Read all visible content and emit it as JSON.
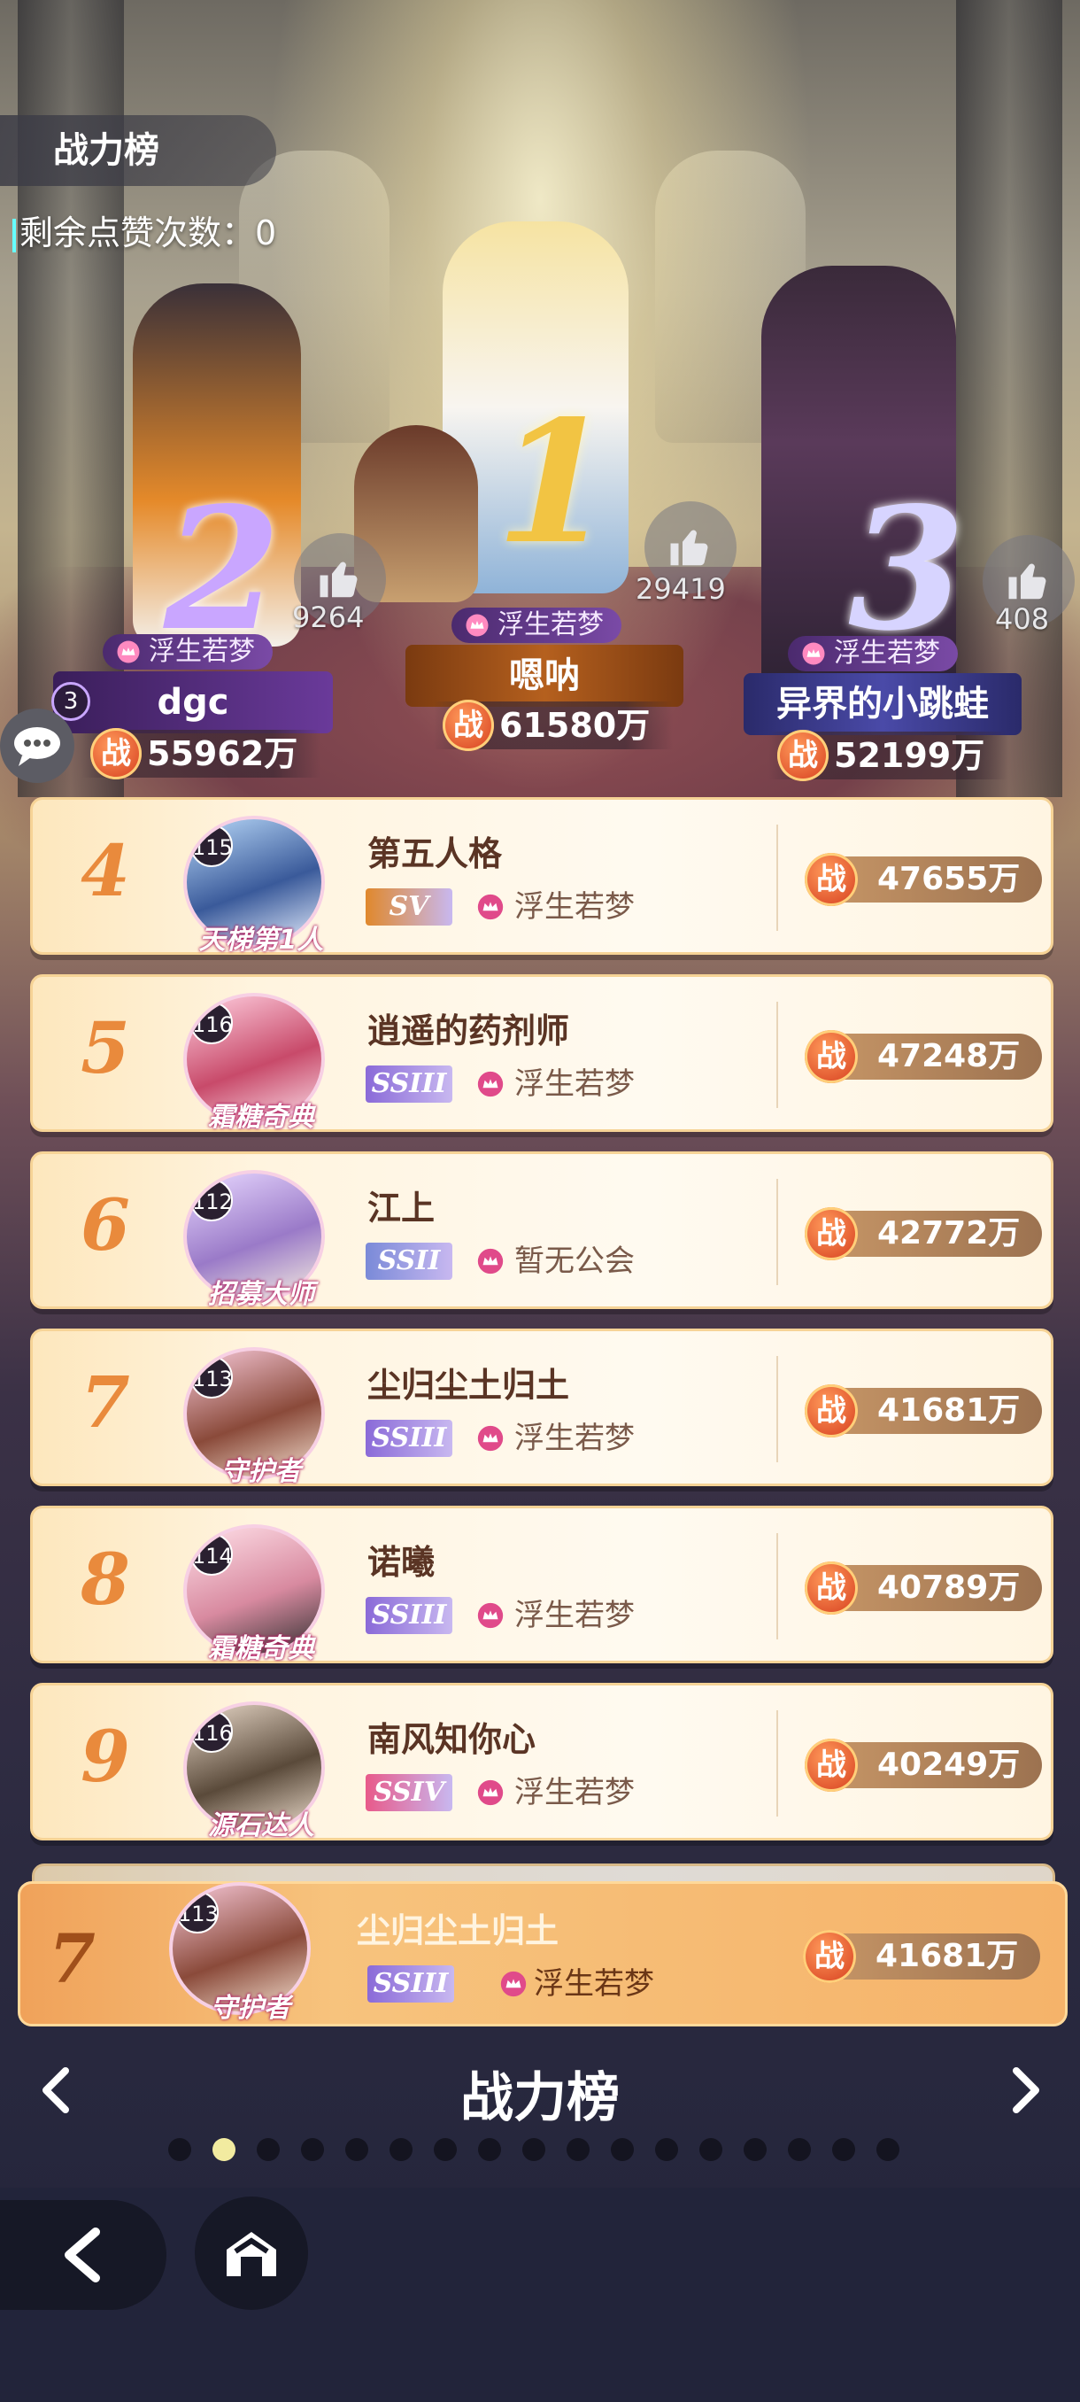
{
  "header": {
    "title": "战力榜",
    "likes_left_label": "剩余点赞次数：",
    "likes_left_value": "0"
  },
  "podium": [
    {
      "rank": "1",
      "guild": "浮生若梦",
      "name": "嗯呐",
      "power": "61580万",
      "likes": "29419"
    },
    {
      "rank": "2",
      "guild": "浮生若梦",
      "name": "dgc",
      "power": "55962万",
      "likes": "9264",
      "level": "3"
    },
    {
      "rank": "3",
      "guild": "浮生若梦",
      "name": "异界的小跳蛙",
      "power": "52199万",
      "likes": "408"
    }
  ],
  "zhan_label": "战",
  "rows": [
    {
      "rank": "4",
      "level": "115",
      "frame": "天梯第1人",
      "name": "第五人格",
      "vip": "SV",
      "vip_color": "#e0882c",
      "guild": "浮生若梦",
      "power": "47655万"
    },
    {
      "rank": "5",
      "level": "116",
      "frame": "霜糖奇典",
      "name": "逍遥的药剂师",
      "vip": "SSIII",
      "vip_color": "#8a6ad8",
      "guild": "浮生若梦",
      "power": "47248万"
    },
    {
      "rank": "6",
      "level": "112",
      "frame": "招募大师",
      "name": "江上",
      "vip": "SSII",
      "vip_color": "#7a8ad8",
      "guild": "暂无公会",
      "power": "42772万"
    },
    {
      "rank": "7",
      "level": "113",
      "frame": "守护者",
      "name": "尘归尘土归土",
      "vip": "SSIII",
      "vip_color": "#8a6ad8",
      "guild": "浮生若梦",
      "power": "41681万"
    },
    {
      "rank": "8",
      "level": "114",
      "frame": "霜糖奇典",
      "name": "诺曦",
      "vip": "SSIII",
      "vip_color": "#8a6ad8",
      "guild": "浮生若梦",
      "power": "40789万"
    },
    {
      "rank": "9",
      "level": "116",
      "frame": "源石达人",
      "name": "南风知你心",
      "vip": "SSIV",
      "vip_color": "#e85a8a",
      "guild": "浮生若梦",
      "power": "40249万"
    }
  ],
  "my_row": {
    "rank": "7",
    "level": "113",
    "frame": "守护者",
    "name": "尘归尘土归土",
    "vip": "SSIII",
    "vip_color": "#8a6ad8",
    "guild": "浮生若梦",
    "power": "41681万"
  },
  "footer": {
    "title": "战力榜",
    "page_count": 17,
    "active_page": 2
  },
  "colors": {
    "accent_orange": "#e98a3c",
    "guild_purple": "#7a4aa6",
    "zhan_red": "#d4391c"
  }
}
